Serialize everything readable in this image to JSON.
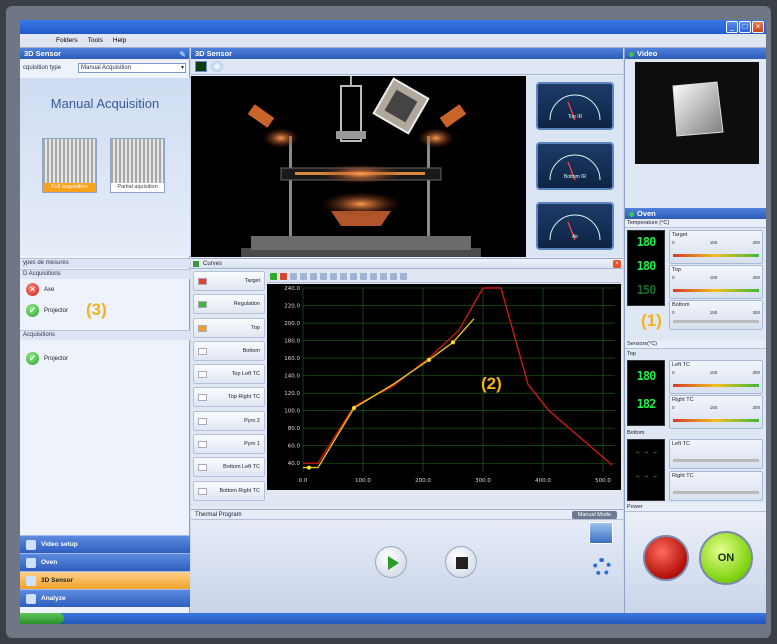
{
  "menu": {
    "items": [
      "Folders",
      "Tools",
      "Help"
    ]
  },
  "left_panel": {
    "title": "3D Sensor",
    "acq_type_label": "cquisition type",
    "acq_type_value": "Manual Acquisition",
    "manual_title": "Manual Acquisition",
    "thumbs": [
      "Full acquisition",
      "Partial aquisition"
    ],
    "sections": [
      "ypes de mesures",
      "D Acquisitions",
      "Acquisitions"
    ],
    "items_3d": [
      "Axe",
      "Projector"
    ],
    "items_acq": [
      "Projector"
    ],
    "nav": [
      "Video setup",
      "Oven",
      "3D Sensor",
      "Analyze"
    ]
  },
  "center": {
    "title": "3D Sensor",
    "gauges": [
      "Top IR",
      "Bottom IR",
      "Air"
    ],
    "curves_title": "Curves",
    "legend": [
      "Target",
      "Regulation",
      "Top",
      "Bottom",
      "Top Left TC",
      "Top Right TC",
      "Pyro 2",
      "Pyro 1",
      "Bottom Left TC",
      "Bottom Right TC"
    ],
    "legend_colors": [
      "#e84030",
      "#3ab83a",
      "#f0a020",
      "",
      "",
      "",
      "",
      "",
      "",
      ""
    ],
    "thermal_label": "Thermal Program",
    "manual_mode": "Manual Mode"
  },
  "chart_data": {
    "type": "line",
    "ylim": [
      30,
      240
    ],
    "xlim": [
      0,
      520
    ],
    "yticks": [
      "240.0",
      "220.0",
      "200.0",
      "180.0",
      "160.0",
      "140.0",
      "120.0",
      "100.0",
      "80.0",
      "60.0",
      "40.0"
    ],
    "xticks": [
      "0.0",
      "100.0",
      "200.0",
      "300.0",
      "400.0",
      "500.0"
    ],
    "series": [
      {
        "color": "#c81818",
        "x": [
          0,
          25,
          85,
          150,
          210,
          260,
          300,
          330,
          375,
          410,
          515
        ],
        "y": [
          40,
          40,
          105,
          128,
          160,
          192,
          240,
          240,
          130,
          100,
          38
        ]
      },
      {
        "color": "#e8c020",
        "x": [
          0,
          25,
          85,
          150,
          210,
          250,
          285
        ],
        "y": [
          35,
          35,
          103,
          130,
          158,
          178,
          205
        ]
      }
    ],
    "markers": {
      "x": [
        10,
        85,
        210,
        250
      ],
      "y": [
        35,
        103,
        158,
        178
      ]
    }
  },
  "right_panel": {
    "video_title": "Video",
    "oven_title": "Oven",
    "temps_label": "Temperature (°C)",
    "sensors_label": "Sensors(°C)",
    "top_label": "Top",
    "bottom_label": "Bottom",
    "power_label": "Power",
    "temp_mini": [
      "Target",
      "Top",
      "Bottom"
    ],
    "sensor_top": [
      "Left TC",
      "Right TC"
    ],
    "sensor_bottom": [
      "Left TC",
      "Right TC"
    ],
    "scale": [
      "0",
      "150",
      "300"
    ],
    "digits_temp": [
      "180",
      "180",
      "150"
    ],
    "digits_sensor_top": [
      "180",
      "182"
    ],
    "digits_sensor_bottom": [
      "- - -",
      "- - -"
    ],
    "on_label": "ON"
  },
  "callouts": [
    "(1)",
    "(2)",
    "(3)"
  ]
}
